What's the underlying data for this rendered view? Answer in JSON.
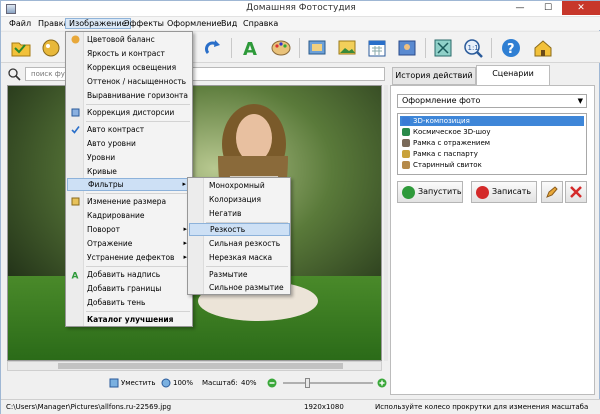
{
  "window": {
    "title": "Домашняя Фотостудия",
    "minimize": "—",
    "maximize": "☐",
    "close": "✕"
  },
  "menubar": {
    "items": [
      "Файл",
      "Правка",
      "Изображение",
      "Эффекты",
      "Оформление",
      "Вид",
      "Справка"
    ],
    "active": "Изображение"
  },
  "toolbar": {
    "icons": [
      "open-folder-icon",
      "effects-icon",
      "undo-icon",
      "redo-icon",
      "text-icon",
      "palette-icon",
      "photo-frame-icon",
      "image-icon",
      "calendar-icon",
      "postcard-icon",
      "fit-window-icon",
      "actual-size-icon",
      "help-icon",
      "home-icon"
    ]
  },
  "search": {
    "placeholder": "поиск фу"
  },
  "image_menu": {
    "items": [
      {
        "label": "Цветовой баланс",
        "icon": "color-balance-icon"
      },
      {
        "label": "Яркость и контраст"
      },
      {
        "label": "Коррекция освещения"
      },
      {
        "label": "Оттенок / насыщенность"
      },
      {
        "label": "Выравнивание горизонта"
      },
      {
        "label": "Коррекция дисторсии",
        "icon": "distortion-icon"
      },
      {
        "label": "Авто контраст",
        "icon": "checkmark-icon"
      },
      {
        "label": "Авто уровни"
      },
      {
        "label": "Уровни"
      },
      {
        "label": "Кривые"
      },
      {
        "label": "Фильтры",
        "submenu": true
      },
      {
        "label": "Изменение размера",
        "icon": "resize-icon"
      },
      {
        "label": "Кадрирование"
      },
      {
        "label": "Поворот",
        "submenu": true
      },
      {
        "label": "Отражение",
        "submenu": true
      },
      {
        "label": "Устранение дефектов",
        "submenu": true
      },
      {
        "label": "Добавить надпись",
        "icon": "text-icon"
      },
      {
        "label": "Добавить границы"
      },
      {
        "label": "Добавить тень"
      },
      {
        "label": "Каталог улучшения"
      }
    ]
  },
  "filters_submenu": {
    "items": [
      "Монохромный",
      "Колоризация",
      "Негатив",
      "Резкость",
      "Сильная резкость",
      "Нерезкая маска",
      "Размытие",
      "Сильное размытие"
    ],
    "highlighted": "Резкость"
  },
  "panel": {
    "tabs": [
      "История действий",
      "Сценарии"
    ],
    "active_tab": "Сценарии",
    "dropdown_value": "Оформление фото",
    "scenarios": [
      {
        "label": "3D-композиция",
        "selected": true,
        "color": "#3a7bd5"
      },
      {
        "label": "Космическое 3D-шоу",
        "color": "#2a8a4a"
      },
      {
        "label": "Рамка с отражением",
        "color": "#7a6a5a"
      },
      {
        "label": "Рамка с паспарту",
        "color": "#c9a23a"
      },
      {
        "label": "Старинный свиток",
        "color": "#b58a4a"
      }
    ],
    "run_button": "Запустить",
    "record_button": "Записать"
  },
  "zoombar": {
    "fit_label": "Уместить",
    "zoom_label": "100%",
    "scale_label": "Масштаб:",
    "scale_value": "40%",
    "slider_fraction": 0.26
  },
  "status": {
    "path": "C:\\Users\\Manager\\Pictures\\allfons.ru-22569.jpg",
    "dimensions": "1920x1080",
    "hint": "Используйте колесо прокрутки для изменения масштаба"
  },
  "colors": {
    "accent": "#3e86d8",
    "menu_highlight": "#cde0f5",
    "close_button": "#c7372b"
  }
}
